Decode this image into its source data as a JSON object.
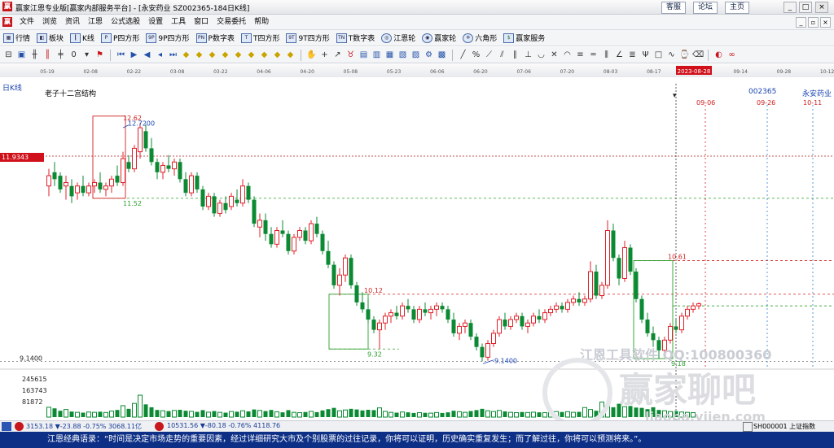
{
  "window": {
    "title": "赢家江恩专业版[赢家内部服务平台] - [永安药业  SZ002365-184日K线]",
    "links": [
      "客服",
      "论坛",
      "主页"
    ],
    "buttons": [
      "_",
      "□",
      "×"
    ]
  },
  "menu": {
    "items": [
      "文件",
      "浏览",
      "资讯",
      "江恩",
      "公式选股",
      "设置",
      "工具",
      "窗口",
      "交易委托",
      "帮助"
    ]
  },
  "toolbar": {
    "items": [
      "行情",
      "板块",
      "K线",
      "P四方形",
      "9P四方形",
      "P数字表",
      "T四方形",
      "9T四方形",
      "T数字表",
      "江恩轮",
      "赢家轮",
      "六角形",
      "赢家服务"
    ]
  },
  "datebar": {
    "dates": [
      "05-19",
      "02-08",
      "02-22",
      "03-08",
      "03-22",
      "04-06",
      "04-20",
      "05-08",
      "05-23",
      "06-06",
      "06-20",
      "07-06",
      "07-20",
      "08-03",
      "08-17",
      "2023-08-28",
      "09-14",
      "09-28",
      "10-12"
    ],
    "highlight": "2023-08-28"
  },
  "chart": {
    "period": "日K线",
    "study": "老子十二宫结构",
    "code": "002365",
    "name": "永安药业",
    "current_price": "11.9343"
  },
  "chart_data": {
    "type": "candlestick",
    "ylim": [
      9.05,
      13.05
    ],
    "ohlc": [
      [
        11.7,
        11.95,
        11.55,
        11.85
      ],
      [
        11.9,
        12.05,
        11.7,
        11.8
      ],
      [
        11.85,
        11.9,
        11.6,
        11.65
      ],
      [
        11.7,
        11.85,
        11.5,
        11.75
      ],
      [
        11.7,
        11.8,
        11.45,
        11.55
      ],
      [
        11.6,
        11.75,
        11.5,
        11.7
      ],
      [
        11.7,
        11.85,
        11.55,
        11.6
      ],
      [
        11.6,
        11.75,
        11.55,
        11.7
      ],
      [
        11.7,
        11.8,
        11.6,
        11.75
      ],
      [
        11.75,
        11.9,
        11.6,
        11.65
      ],
      [
        11.65,
        11.75,
        11.55,
        11.7
      ],
      [
        11.7,
        11.85,
        11.6,
        11.8
      ],
      [
        11.85,
        12.0,
        11.7,
        11.75
      ],
      [
        11.75,
        12.2,
        11.7,
        12.1
      ],
      [
        12.05,
        12.15,
        11.9,
        11.95
      ],
      [
        11.95,
        12.3,
        11.9,
        12.25
      ],
      [
        12.2,
        12.62,
        12.1,
        12.55
      ],
      [
        12.5,
        12.6,
        12.2,
        12.25
      ],
      [
        12.25,
        12.4,
        12.0,
        12.05
      ],
      [
        12.05,
        12.1,
        11.8,
        11.9
      ],
      [
        11.9,
        12.05,
        11.8,
        12.0
      ],
      [
        12.0,
        12.15,
        11.9,
        11.95
      ],
      [
        11.95,
        12.1,
        11.85,
        12.05
      ],
      [
        12.05,
        12.1,
        11.75,
        11.8
      ],
      [
        11.8,
        11.9,
        11.55,
        11.6
      ],
      [
        11.6,
        11.9,
        11.55,
        11.85
      ],
      [
        11.85,
        11.9,
        11.6,
        11.65
      ],
      [
        11.65,
        11.7,
        11.35,
        11.4
      ],
      [
        11.4,
        11.6,
        11.35,
        11.55
      ],
      [
        11.55,
        11.6,
        11.25,
        11.3
      ],
      [
        11.3,
        11.5,
        11.25,
        11.45
      ],
      [
        11.45,
        11.55,
        11.3,
        11.35
      ],
      [
        11.4,
        11.6,
        11.35,
        11.55
      ],
      [
        11.5,
        11.65,
        11.4,
        11.45
      ],
      [
        11.45,
        11.8,
        11.4,
        11.7
      ],
      [
        11.7,
        11.75,
        11.45,
        11.5
      ],
      [
        11.5,
        11.55,
        11.1,
        11.15
      ],
      [
        11.1,
        11.3,
        10.95,
        11.2
      ],
      [
        11.2,
        11.3,
        10.9,
        11.0
      ],
      [
        11.0,
        11.1,
        10.8,
        10.85
      ],
      [
        10.85,
        11.1,
        10.8,
        11.05
      ],
      [
        11.05,
        11.2,
        10.95,
        11.0
      ],
      [
        11.0,
        11.05,
        10.7,
        10.75
      ],
      [
        10.75,
        11.0,
        10.7,
        10.95
      ],
      [
        10.95,
        11.1,
        10.9,
        11.05
      ],
      [
        11.05,
        11.1,
        10.85,
        10.9
      ],
      [
        10.9,
        11.2,
        10.85,
        11.15
      ],
      [
        11.15,
        11.25,
        10.95,
        11.0
      ],
      [
        11.0,
        11.05,
        10.7,
        10.75
      ],
      [
        10.75,
        10.9,
        10.5,
        10.55
      ],
      [
        10.55,
        10.6,
        10.2,
        10.25
      ],
      [
        10.25,
        10.5,
        10.1,
        10.4
      ],
      [
        10.4,
        10.7,
        10.3,
        10.65
      ],
      [
        10.65,
        10.7,
        10.2,
        10.25
      ],
      [
        10.25,
        10.3,
        9.95,
        10.0
      ],
      [
        10.0,
        10.15,
        9.85,
        9.9
      ],
      [
        9.9,
        10.05,
        9.7,
        9.75
      ],
      [
        9.75,
        9.8,
        9.55,
        9.6
      ],
      [
        9.6,
        9.75,
        9.32,
        9.7
      ],
      [
        9.7,
        9.85,
        9.6,
        9.8
      ],
      [
        9.8,
        9.9,
        9.7,
        9.85
      ],
      [
        9.85,
        9.95,
        9.75,
        9.8
      ],
      [
        9.8,
        10.0,
        9.75,
        9.95
      ],
      [
        9.95,
        10.05,
        9.85,
        9.9
      ],
      [
        9.9,
        9.95,
        9.7,
        9.75
      ],
      [
        9.75,
        9.95,
        9.7,
        9.9
      ],
      [
        9.9,
        10.0,
        9.8,
        9.85
      ],
      [
        9.85,
        9.95,
        9.75,
        9.9
      ],
      [
        9.9,
        10.0,
        9.8,
        9.95
      ],
      [
        9.95,
        10.0,
        9.85,
        9.9
      ],
      [
        9.9,
        9.95,
        9.7,
        9.75
      ],
      [
        9.75,
        9.85,
        9.5,
        9.55
      ],
      [
        9.55,
        9.7,
        9.45,
        9.65
      ],
      [
        9.65,
        9.75,
        9.55,
        9.7
      ],
      [
        9.7,
        9.75,
        9.45,
        9.5
      ],
      [
        9.5,
        9.55,
        9.3,
        9.35
      ],
      [
        9.35,
        9.4,
        9.14,
        9.2
      ],
      [
        9.2,
        9.45,
        9.15,
        9.4
      ],
      [
        9.4,
        9.6,
        9.35,
        9.55
      ],
      [
        9.55,
        9.8,
        9.5,
        9.75
      ],
      [
        9.75,
        9.85,
        9.6,
        9.65
      ],
      [
        9.65,
        9.8,
        9.6,
        9.75
      ],
      [
        9.75,
        9.85,
        9.7,
        9.8
      ],
      [
        9.8,
        9.85,
        9.6,
        9.65
      ],
      [
        9.65,
        9.75,
        9.55,
        9.7
      ],
      [
        9.7,
        9.85,
        9.65,
        9.8
      ],
      [
        9.8,
        9.9,
        9.7,
        9.75
      ],
      [
        9.75,
        9.9,
        9.7,
        9.85
      ],
      [
        9.85,
        9.95,
        9.8,
        9.9
      ],
      [
        9.9,
        10.0,
        9.85,
        9.95
      ],
      [
        9.95,
        10.0,
        9.85,
        9.9
      ],
      [
        9.9,
        10.05,
        9.85,
        10.0
      ],
      [
        10.0,
        10.1,
        9.95,
        10.05
      ],
      [
        10.05,
        10.15,
        9.95,
        10.0
      ],
      [
        10.0,
        10.1,
        9.95,
        10.05
      ],
      [
        10.05,
        10.6,
        10.0,
        10.45
      ],
      [
        10.45,
        10.55,
        10.05,
        10.1
      ],
      [
        10.1,
        10.3,
        10.05,
        10.25
      ],
      [
        10.25,
        11.2,
        10.2,
        11.05
      ],
      [
        11.05,
        11.15,
        10.6,
        10.65
      ],
      [
        10.65,
        10.7,
        10.25,
        10.35
      ],
      [
        10.35,
        10.9,
        10.3,
        10.8
      ],
      [
        10.8,
        10.85,
        10.4,
        10.45
      ],
      [
        10.45,
        10.5,
        10.0,
        10.05
      ],
      [
        10.05,
        10.1,
        9.7,
        9.75
      ],
      [
        9.75,
        9.85,
        9.5,
        9.55
      ],
      [
        9.55,
        9.65,
        9.35,
        9.45
      ],
      [
        9.45,
        9.5,
        9.18,
        9.3
      ],
      [
        9.3,
        9.5,
        9.25,
        9.45
      ],
      [
        9.45,
        9.7,
        9.4,
        9.65
      ],
      [
        9.65,
        9.75,
        9.55,
        9.6
      ],
      [
        9.6,
        9.85,
        9.55,
        9.8
      ],
      [
        9.8,
        9.95,
        9.75,
        9.9
      ],
      [
        9.9,
        10.0,
        9.85,
        9.95
      ],
      [
        9.95,
        10.0,
        9.9,
        9.98
      ]
    ],
    "volume": [
      62000,
      55000,
      40000,
      48000,
      35000,
      30000,
      28000,
      32000,
      30000,
      34000,
      29000,
      38000,
      45000,
      72000,
      52000,
      86000,
      138000,
      80000,
      62000,
      45000,
      40000,
      38000,
      42000,
      46000,
      40000,
      36000,
      33000,
      44000,
      31000,
      38000,
      30000,
      28000,
      35000,
      34000,
      40000,
      36000,
      48000,
      42000,
      38000,
      45000,
      33000,
      30000,
      44000,
      30000,
      28000,
      32000,
      36000,
      31000,
      42000,
      50000,
      58000,
      40000,
      45000,
      52000,
      48000,
      42000,
      46000,
      44000,
      58000,
      36000,
      30000,
      28000,
      32000,
      30000,
      26000,
      28000,
      27000,
      25000,
      29000,
      26000,
      30000,
      40000,
      34000,
      30000,
      38000,
      44000,
      52000,
      40000,
      35000,
      42000,
      36000,
      30000,
      28000,
      32000,
      29000,
      31000,
      30000,
      28000,
      33000,
      35000,
      32000,
      34000,
      30000,
      33000,
      60000,
      48000,
      40000,
      95000,
      75000,
      62000,
      84000,
      66000,
      70000,
      60000,
      58000,
      50000,
      62000,
      45000,
      40000,
      35000,
      38000,
      32000,
      30000,
      28000
    ],
    "volume_ticks": [
      "245615",
      "163743",
      "81872"
    ],
    "high_label": "12.62",
    "high_label2": "12.7200",
    "low_label": "9.1400",
    "axis_labels": [
      "9.1400"
    ],
    "levels": [
      {
        "value": "11.52"
      },
      {
        "value": "10.12"
      },
      {
        "value": "9.32"
      },
      {
        "value": "10.61"
      },
      {
        "value": "9.18"
      }
    ],
    "future_dates": [
      "09-06",
      "09-26",
      "10-11"
    ]
  },
  "watermark": {
    "line1": "江恩工具软件 QQ:100800360",
    "brand": "赢家聊吧",
    "site": "liaoba.yjjen.com"
  },
  "status": {
    "sh": "3153.18 ▼-23.88 -0.75% 3068.11亿",
    "sz": "10531.56 ▼-80.18 -0.76% 4118.76",
    "index": "SH000001 上证指数"
  },
  "quote": "江恩经典语录：“时间是决定市场走势的重要因素，经过详细研究大市及个别股票的过往记录，你将可以证明，历史确实重复发生；而了解过往，你将可以预测将来。”。"
}
